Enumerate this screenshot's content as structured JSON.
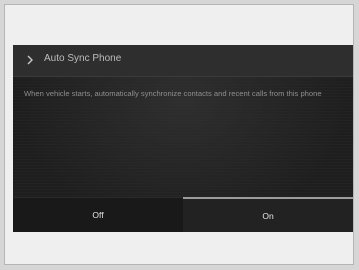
{
  "screen": {
    "header": {
      "icon": "chevron-right-icon",
      "title": "Auto Sync Phone"
    },
    "description": "When vehicle starts, automatically synchronize contacts and recent calls from this phone",
    "buttons": {
      "off_label": "Off",
      "on_label": "On",
      "selected": "On"
    }
  }
}
